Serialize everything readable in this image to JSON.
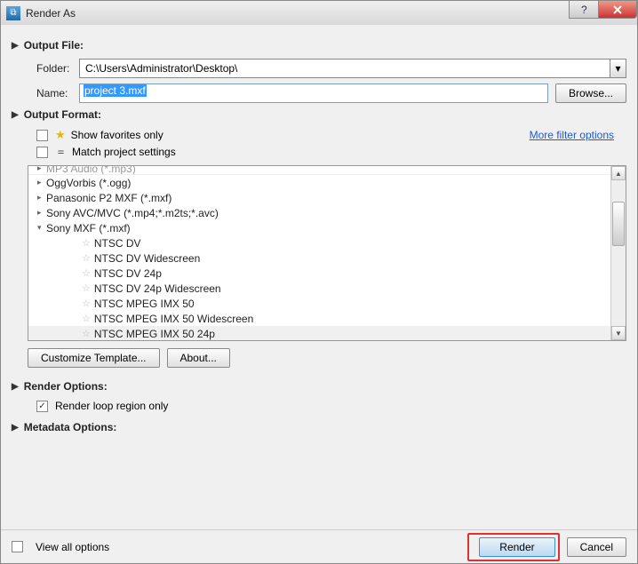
{
  "window": {
    "title": "Render As"
  },
  "output_file": {
    "header": "Output File:",
    "folder_label": "Folder:",
    "folder_value": "C:\\Users\\Administrator\\Desktop\\",
    "name_label": "Name:",
    "name_value": "project 3.mxf",
    "browse": "Browse..."
  },
  "output_format": {
    "header": "Output Format:",
    "show_fav": "Show favorites only",
    "match_proj": "Match project settings",
    "more_filter": "More filter options",
    "formats": [
      {
        "label": "MP3 Audio (*.mp3)",
        "cut": true
      },
      {
        "label": "OggVorbis (*.ogg)"
      },
      {
        "label": "Panasonic P2 MXF (*.mxf)"
      },
      {
        "label": "Sony AVC/MVC (*.mp4;*.m2ts;*.avc)"
      },
      {
        "label": "Sony MXF (*.mxf)",
        "expanded": true
      }
    ],
    "templates": [
      "NTSC DV",
      "NTSC DV Widescreen",
      "NTSC DV 24p",
      "NTSC DV 24p Widescreen",
      "NTSC MPEG IMX 50",
      "NTSC MPEG IMX 50 Widescreen",
      "NTSC MPEG IMX 50 24p"
    ],
    "customize": "Customize Template...",
    "about": "About..."
  },
  "render_options": {
    "header": "Render Options:",
    "loop": "Render loop region only"
  },
  "metadata": {
    "header": "Metadata Options:"
  },
  "footer": {
    "view_all": "View all options",
    "render": "Render",
    "cancel": "Cancel"
  }
}
